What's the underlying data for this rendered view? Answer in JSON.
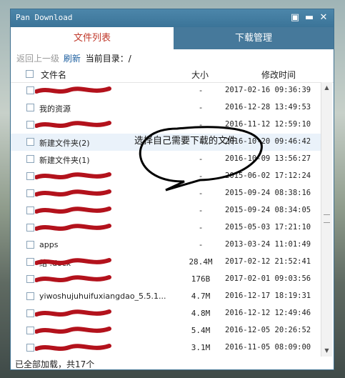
{
  "window": {
    "title": "Pan Download"
  },
  "tabs": [
    {
      "label": "文件列表",
      "active": true
    },
    {
      "label": "下载管理",
      "active": false
    }
  ],
  "pathbar": {
    "back": "返回上一级",
    "refresh": "刷新",
    "current": "当前目录：/"
  },
  "columns": {
    "name": "文件名",
    "size": "大小",
    "time": "修改时间"
  },
  "rows": [
    {
      "name": "",
      "size": "-",
      "time": "2017-02-16 09:36:39",
      "redacted": true
    },
    {
      "name": "我的资源",
      "size": "-",
      "time": "2016-12-28 13:49:53",
      "redacted": false
    },
    {
      "name": "",
      "size": "-",
      "time": "2016-11-12 12:59:10",
      "redacted": true
    },
    {
      "name": "新建文件夹(2)",
      "size": "-",
      "time": "2016-10-20 09:46:42",
      "redacted": false,
      "highlighted": true
    },
    {
      "name": "新建文件夹(1)",
      "size": "-",
      "time": "2016-10-09 13:56:27",
      "redacted": false
    },
    {
      "name": "",
      "size": "-",
      "time": "2015-06-02 17:12:24",
      "redacted": true
    },
    {
      "name": "",
      "size": "-",
      "time": "2015-09-24 08:38:16",
      "redacted": true
    },
    {
      "name": "",
      "size": "-",
      "time": "2015-09-24 08:34:05",
      "redacted": true
    },
    {
      "name": "",
      "size": "-",
      "time": "2015-05-03 17:21:10",
      "redacted": true
    },
    {
      "name": "apps",
      "size": "-",
      "time": "2013-03-24 11:01:49",
      "redacted": false
    },
    {
      "name": "结 .docx",
      "size": "28.4M",
      "time": "2017-02-12 21:52:41",
      "redacted": true
    },
    {
      "name": "",
      "size": "176B",
      "time": "2017-02-01 09:03:56",
      "redacted": true
    },
    {
      "name": "yiwoshujuhuifuxiangdao_5.5.1...",
      "size": "4.7M",
      "time": "2016-12-17 18:19:31",
      "redacted": false
    },
    {
      "name": "",
      "size": "4.8M",
      "time": "2016-12-12 12:49:46",
      "redacted": true
    },
    {
      "name": "",
      "size": "5.4M",
      "time": "2016-12-05 20:26:52",
      "redacted": true
    },
    {
      "name": "",
      "size": "3.1M",
      "time": "2016-11-05 08:09:00",
      "redacted": true
    }
  ],
  "status": "已全部加载，共17个",
  "annotation": "选择自己需要下载的文件",
  "colors": {
    "accent": "#3b7498",
    "active_tab_text": "#c0392b",
    "redaction": "#b3121c"
  }
}
